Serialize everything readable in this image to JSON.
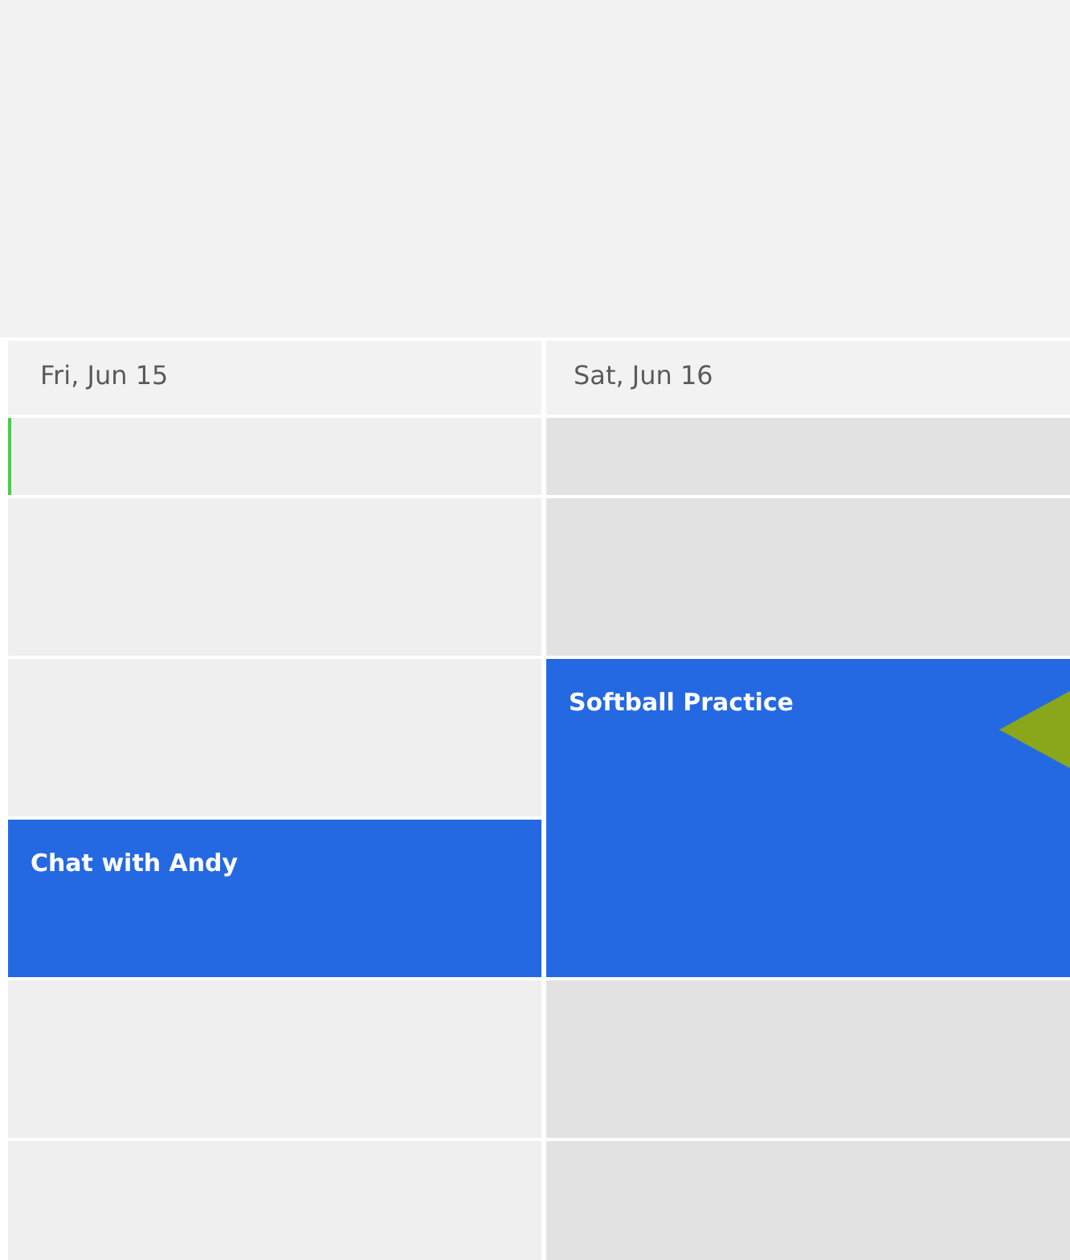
{
  "days": [
    {
      "label": "Fri, Jun 15",
      "weekend": false,
      "cells": [
        {
          "kind": "empty",
          "now": true
        },
        {
          "kind": "empty",
          "now": false
        },
        {
          "kind": "empty",
          "now": false
        },
        {
          "kind": "event",
          "title": "Chat with Andy"
        },
        {
          "kind": "empty",
          "now": false
        },
        {
          "kind": "empty",
          "now": false
        }
      ]
    },
    {
      "label": "Sat, Jun 16",
      "weekend": true,
      "cells": [
        {
          "kind": "empty",
          "now": false
        },
        {
          "kind": "empty",
          "now": false
        },
        {
          "kind": "event",
          "title": "Softball Practice"
        },
        {
          "kind": "continue"
        },
        {
          "kind": "empty",
          "now": false
        },
        {
          "kind": "empty",
          "now": false
        }
      ]
    }
  ]
}
